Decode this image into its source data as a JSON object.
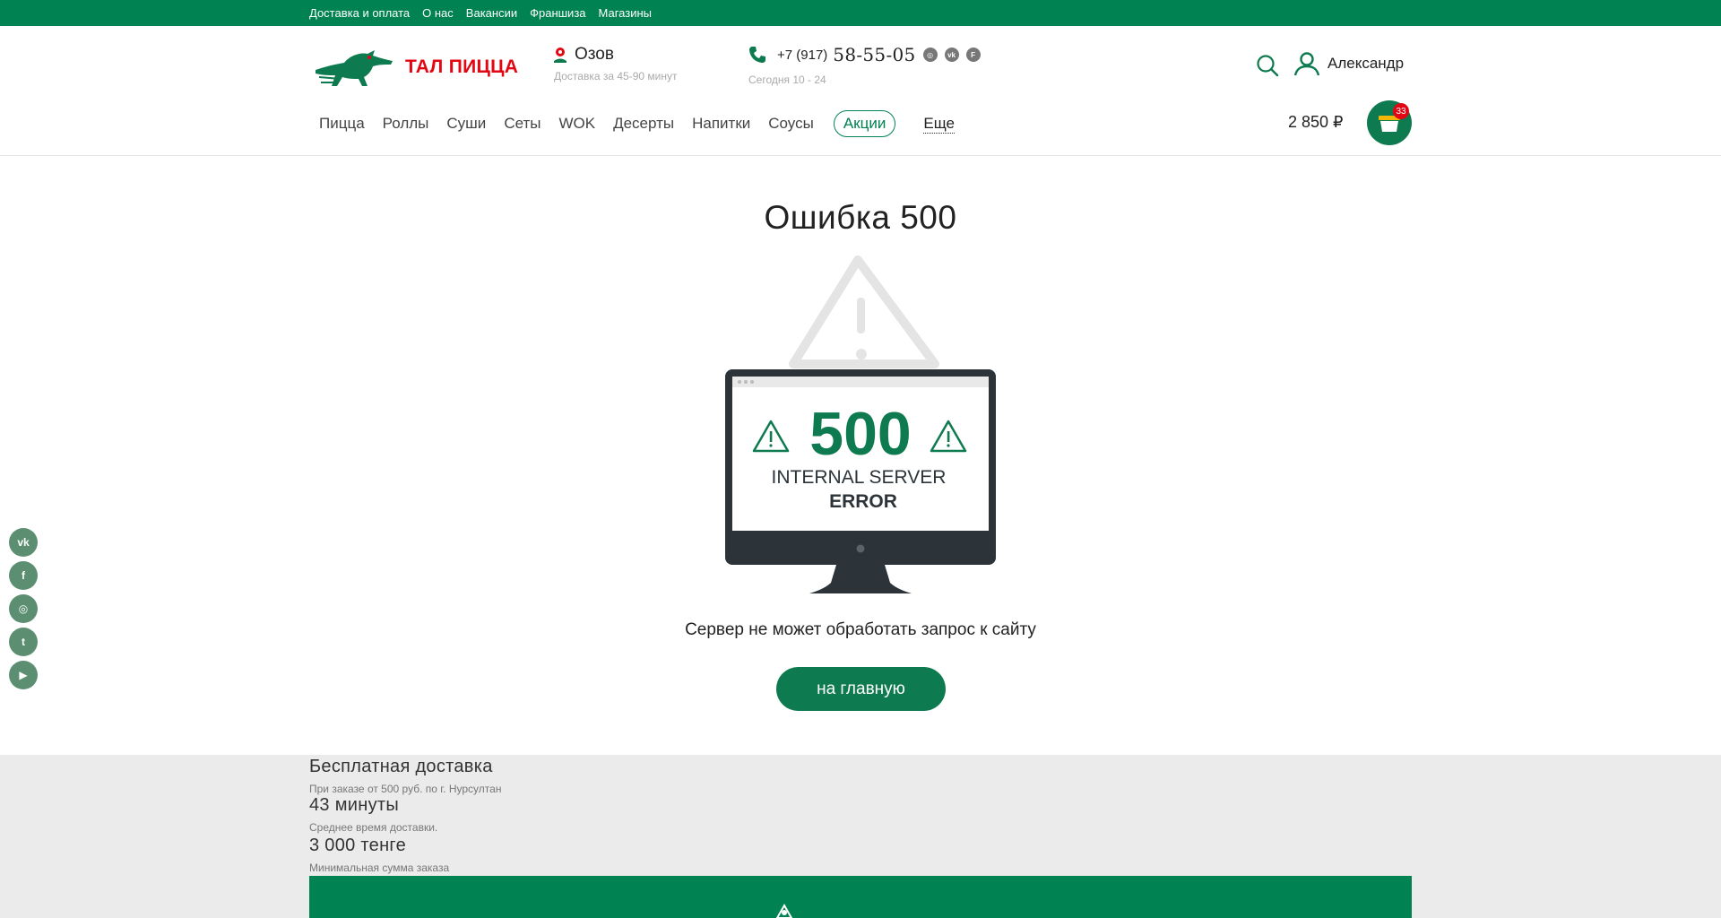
{
  "topbar": {
    "links": [
      "Доставка и оплата",
      "О нас",
      "Вакансии",
      "Франшиза",
      "Магазины"
    ]
  },
  "header": {
    "logo_text": "ТАЛ ПИЦЦА",
    "city": "Озов",
    "delivery_time": "Доставка за 45-90 минут",
    "phone_code": "+7 (917)",
    "phone_number": "58-55-05",
    "hours": "Сегодня 10 - 24",
    "user_name": "Александр",
    "cart_sum": "2 850 ₽",
    "cart_count": "33"
  },
  "menu": {
    "items": [
      "Пицца",
      "Роллы",
      "Суши",
      "Сеты",
      "WOK",
      "Десерты",
      "Напитки",
      "Соусы"
    ],
    "promo": "Акции",
    "more": "Еще"
  },
  "main": {
    "title": "Ошибка 500",
    "code": "500",
    "line1": "INTERNAL SERVER",
    "line2": "ERROR",
    "message": "Сервер не может обработать запрос к сайту",
    "home_button": "на главную"
  },
  "footer": {
    "free_title": "Бесплатная доставка",
    "free_sub": "При заказе от 500 руб. по г. Нурсултан",
    "time_title": "43 минуты",
    "time_sub": "Среднее время доставки.",
    "min_title": "3 000 тенге",
    "min_sub": "Минимальная сумма заказа"
  },
  "colors": {
    "brand_green": "#008253",
    "accent_red": "#e30613",
    "footer_bg": "#ebebeb"
  },
  "icons": [
    "phone-icon",
    "location-icon",
    "instagram-icon",
    "vk-icon",
    "foursquare-icon",
    "search-icon",
    "user-icon",
    "basket-icon",
    "facebook-icon",
    "twitter-icon",
    "youtube-icon",
    "warning-icon",
    "monitor-icon"
  ]
}
